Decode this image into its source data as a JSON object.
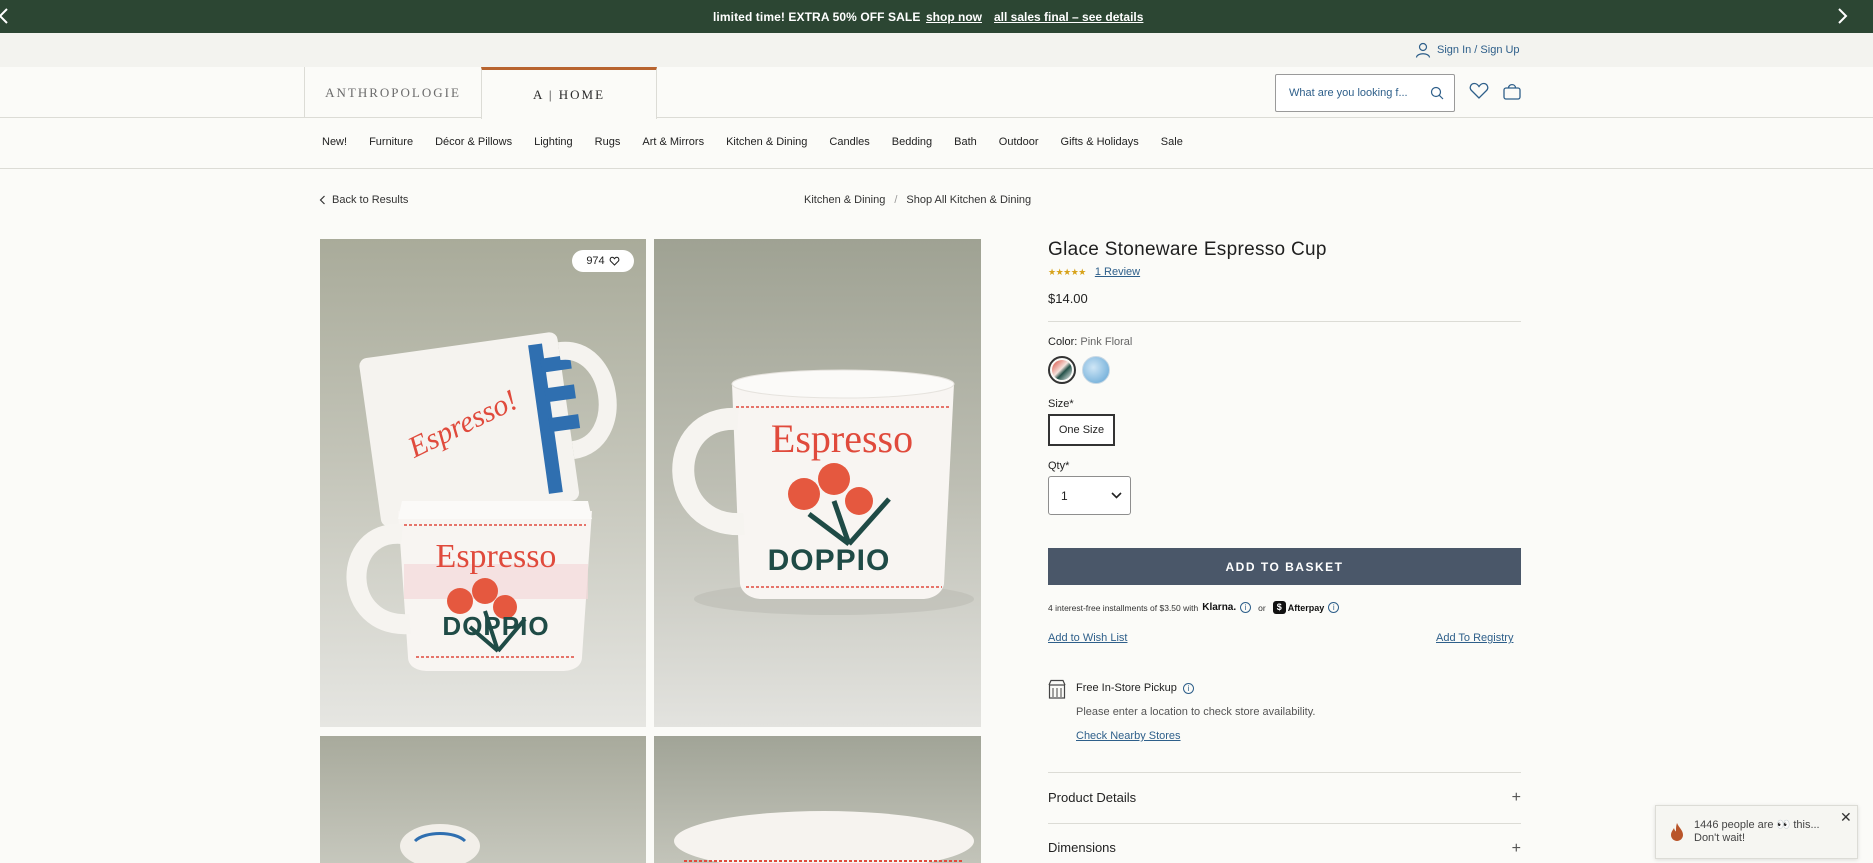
{
  "promo": {
    "message": "limited time! EXTRA 50% OFF SALE",
    "shop_link": "shop now",
    "final_link": "all sales final – see details"
  },
  "utility": {
    "signin": "Sign In / Sign Up"
  },
  "header": {
    "brand_anthro": "ANTHROPOLOGIE",
    "brand_home": "A | HOME",
    "search_placeholder": "What are you looking f..."
  },
  "nav": {
    "items": [
      "New!",
      "Furniture",
      "Décor & Pillows",
      "Lighting",
      "Rugs",
      "Art & Mirrors",
      "Kitchen & Dining",
      "Candles",
      "Bedding",
      "Bath",
      "Outdoor",
      "Gifts & Holidays",
      "Sale"
    ]
  },
  "breadcrumb": {
    "back": "Back to Results",
    "items": [
      "Kitchen & Dining",
      "Shop All Kitchen & Dining"
    ],
    "separator": "/"
  },
  "gallery": {
    "likes": "974",
    "mug_text_1": "Espresso",
    "mug_text_2": "DOPPIO",
    "mug_script": "Espresso!"
  },
  "product": {
    "title": "Glace Stoneware Espresso Cup",
    "stars": "★★★★★",
    "rating_value": 5,
    "reviews_link": "1 Review",
    "price": "$14.00",
    "color_label": "Color:",
    "color_value": "Pink Floral",
    "size_label": "Size*",
    "size_option": "One Size",
    "qty_label": "Qty*",
    "qty_value": "1",
    "add_button": "ADD TO BASKET",
    "installments_text": "4 interest-free installments of $3.50 with",
    "klarna": "Klarna.",
    "or": "or",
    "afterpay": "Afterpay",
    "wish_list": "Add to Wish List",
    "registry": "Add To Registry",
    "pickup_title": "Free In-Store Pickup",
    "pickup_desc": "Please enter a location to check store availability.",
    "nearby": "Check Nearby Stores",
    "accordion": [
      "Product Details",
      "Dimensions"
    ]
  },
  "toast": {
    "text": "1446 people are 👀 this... Don't wait!"
  },
  "colors": {
    "promo_bg": "#2c4633",
    "button_bg": "#4a5769",
    "link": "#2e5f8a",
    "brand_accent": "#b8642f",
    "stars": "#d7a21a"
  }
}
